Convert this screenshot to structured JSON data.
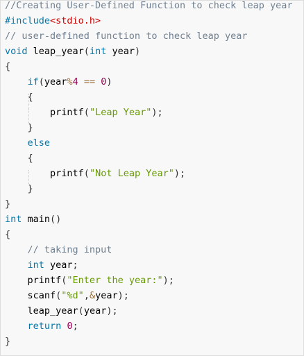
{
  "colors": {
    "background": "#f8f8f8",
    "border": "#dddddd",
    "comment": "#708090",
    "keyword": "#0077aa",
    "string": "#669900",
    "number": "#990055",
    "operator": "#9a6e3a",
    "punct": "#333333",
    "plain": "#000000",
    "preproc": "#0077aa",
    "include": "#cc0000"
  },
  "code": {
    "language": "c",
    "lines": [
      [
        {
          "t": "comment",
          "v": "//Creating User-Defined Function to check leap year"
        }
      ],
      [
        {
          "t": "preproc",
          "v": "#include"
        },
        {
          "t": "include",
          "v": "<stdio.h>"
        }
      ],
      [
        {
          "t": "comment",
          "v": "// user-defined function to check leap year"
        }
      ],
      [
        {
          "t": "keyword",
          "v": "void"
        },
        {
          "t": "plain",
          "v": " leap_year"
        },
        {
          "t": "punct",
          "v": "("
        },
        {
          "t": "keyword",
          "v": "int"
        },
        {
          "t": "plain",
          "v": " year"
        },
        {
          "t": "punct",
          "v": ")"
        }
      ],
      [
        {
          "t": "punct",
          "v": "{"
        }
      ],
      [
        {
          "t": "plain",
          "v": "    "
        },
        {
          "t": "keyword",
          "v": "if"
        },
        {
          "t": "punct",
          "v": "("
        },
        {
          "t": "plain",
          "v": "year"
        },
        {
          "t": "operator",
          "v": "%"
        },
        {
          "t": "number",
          "v": "4"
        },
        {
          "t": "plain",
          "v": " "
        },
        {
          "t": "operator",
          "v": "=="
        },
        {
          "t": "plain",
          "v": " "
        },
        {
          "t": "number",
          "v": "0"
        },
        {
          "t": "punct",
          "v": ")"
        }
      ],
      [
        {
          "t": "plain",
          "v": "    "
        },
        {
          "t": "punct",
          "v": "{"
        }
      ],
      [
        {
          "t": "plain",
          "v": "        printf"
        },
        {
          "t": "punct",
          "v": "("
        },
        {
          "t": "string",
          "v": "\"Leap Year\""
        },
        {
          "t": "punct",
          "v": ");"
        }
      ],
      [
        {
          "t": "plain",
          "v": "    "
        },
        {
          "t": "punct",
          "v": "}"
        }
      ],
      [
        {
          "t": "plain",
          "v": "    "
        },
        {
          "t": "keyword",
          "v": "else"
        }
      ],
      [
        {
          "t": "plain",
          "v": "    "
        },
        {
          "t": "punct",
          "v": "{"
        }
      ],
      [
        {
          "t": "plain",
          "v": "        printf"
        },
        {
          "t": "punct",
          "v": "("
        },
        {
          "t": "string",
          "v": "\"Not Leap Year\""
        },
        {
          "t": "punct",
          "v": ");"
        }
      ],
      [
        {
          "t": "plain",
          "v": "    "
        },
        {
          "t": "punct",
          "v": "}"
        }
      ],
      [
        {
          "t": "punct",
          "v": "}"
        }
      ],
      [
        {
          "t": "keyword",
          "v": "int"
        },
        {
          "t": "plain",
          "v": " main"
        },
        {
          "t": "punct",
          "v": "()"
        }
      ],
      [
        {
          "t": "punct",
          "v": "{"
        }
      ],
      [
        {
          "t": "plain",
          "v": "    "
        },
        {
          "t": "comment",
          "v": "// taking input"
        }
      ],
      [
        {
          "t": "plain",
          "v": "    "
        },
        {
          "t": "keyword",
          "v": "int"
        },
        {
          "t": "plain",
          "v": " year"
        },
        {
          "t": "punct",
          "v": ";"
        }
      ],
      [
        {
          "t": "plain",
          "v": "    printf"
        },
        {
          "t": "punct",
          "v": "("
        },
        {
          "t": "string",
          "v": "\"Enter the year:\""
        },
        {
          "t": "punct",
          "v": ");"
        }
      ],
      [
        {
          "t": "plain",
          "v": "    scanf"
        },
        {
          "t": "punct",
          "v": "("
        },
        {
          "t": "string",
          "v": "\"%d\""
        },
        {
          "t": "punct",
          "v": ","
        },
        {
          "t": "operator",
          "v": "&"
        },
        {
          "t": "plain",
          "v": "year"
        },
        {
          "t": "punct",
          "v": ");"
        }
      ],
      [
        {
          "t": "plain",
          "v": "    leap_year"
        },
        {
          "t": "punct",
          "v": "("
        },
        {
          "t": "plain",
          "v": "year"
        },
        {
          "t": "punct",
          "v": ");"
        }
      ],
      [
        {
          "t": "plain",
          "v": "    "
        },
        {
          "t": "keyword",
          "v": "return"
        },
        {
          "t": "plain",
          "v": " "
        },
        {
          "t": "number",
          "v": "0"
        },
        {
          "t": "punct",
          "v": ";"
        }
      ],
      [
        {
          "t": "punct",
          "v": "}"
        }
      ]
    ]
  }
}
